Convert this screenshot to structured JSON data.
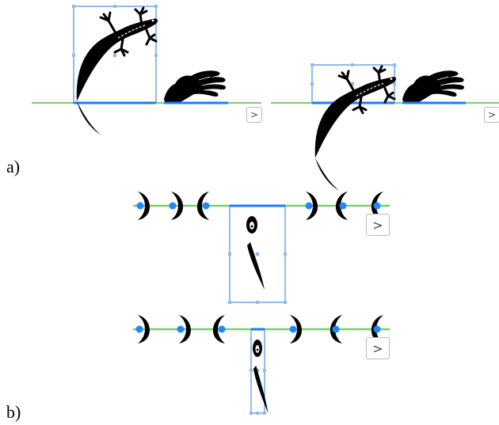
{
  "labels": {
    "panel_a": "a)",
    "panel_b": "b)"
  },
  "buttons": {
    "next_glyph": ">"
  },
  "colors": {
    "baseline": "#7ccc6e",
    "selection": "#4a90e2",
    "selection_edge": "#1f78ff",
    "anchor": "#1e88ff",
    "glyph": "#000000"
  },
  "icons": [
    "lizard-icon",
    "hand-icon",
    "crescent-moon-icon",
    "exclamation-glyph-icon",
    "chevron-right-icon"
  ]
}
